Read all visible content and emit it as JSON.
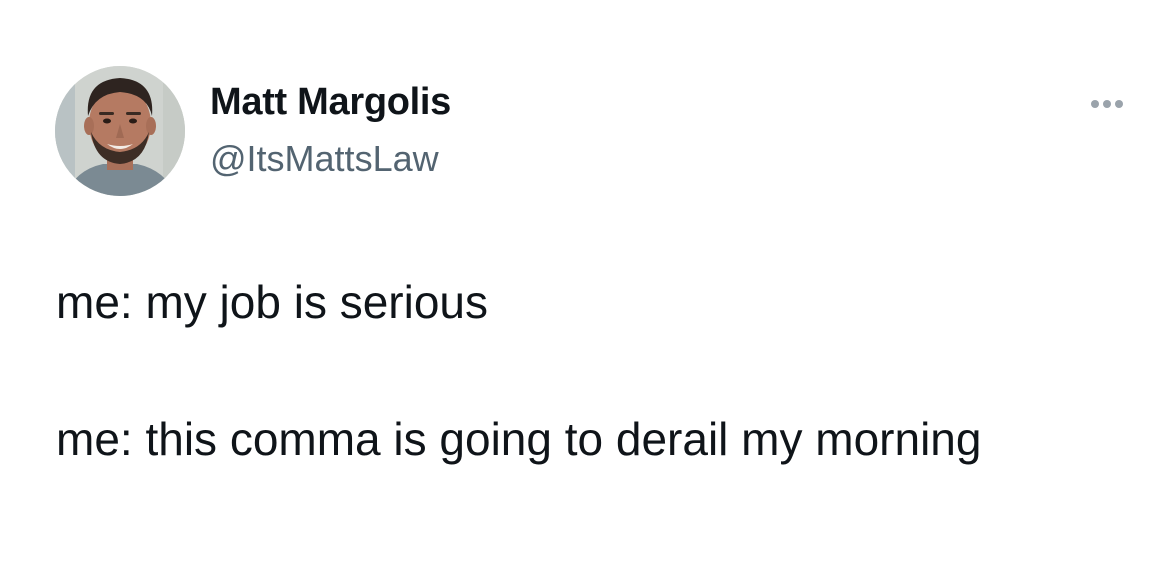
{
  "tweet": {
    "author": {
      "display_name": "Matt Margolis",
      "handle": "@ItsMattsLaw",
      "avatar_icon": "profile-photo"
    },
    "more_icon": "more-horizontal-icon",
    "body_lines": [
      "me: my job is serious",
      "me: this comma is going to derail my morning"
    ]
  },
  "colors": {
    "text_primary": "#0f1419",
    "text_secondary": "#536471",
    "background": "#ffffff"
  }
}
